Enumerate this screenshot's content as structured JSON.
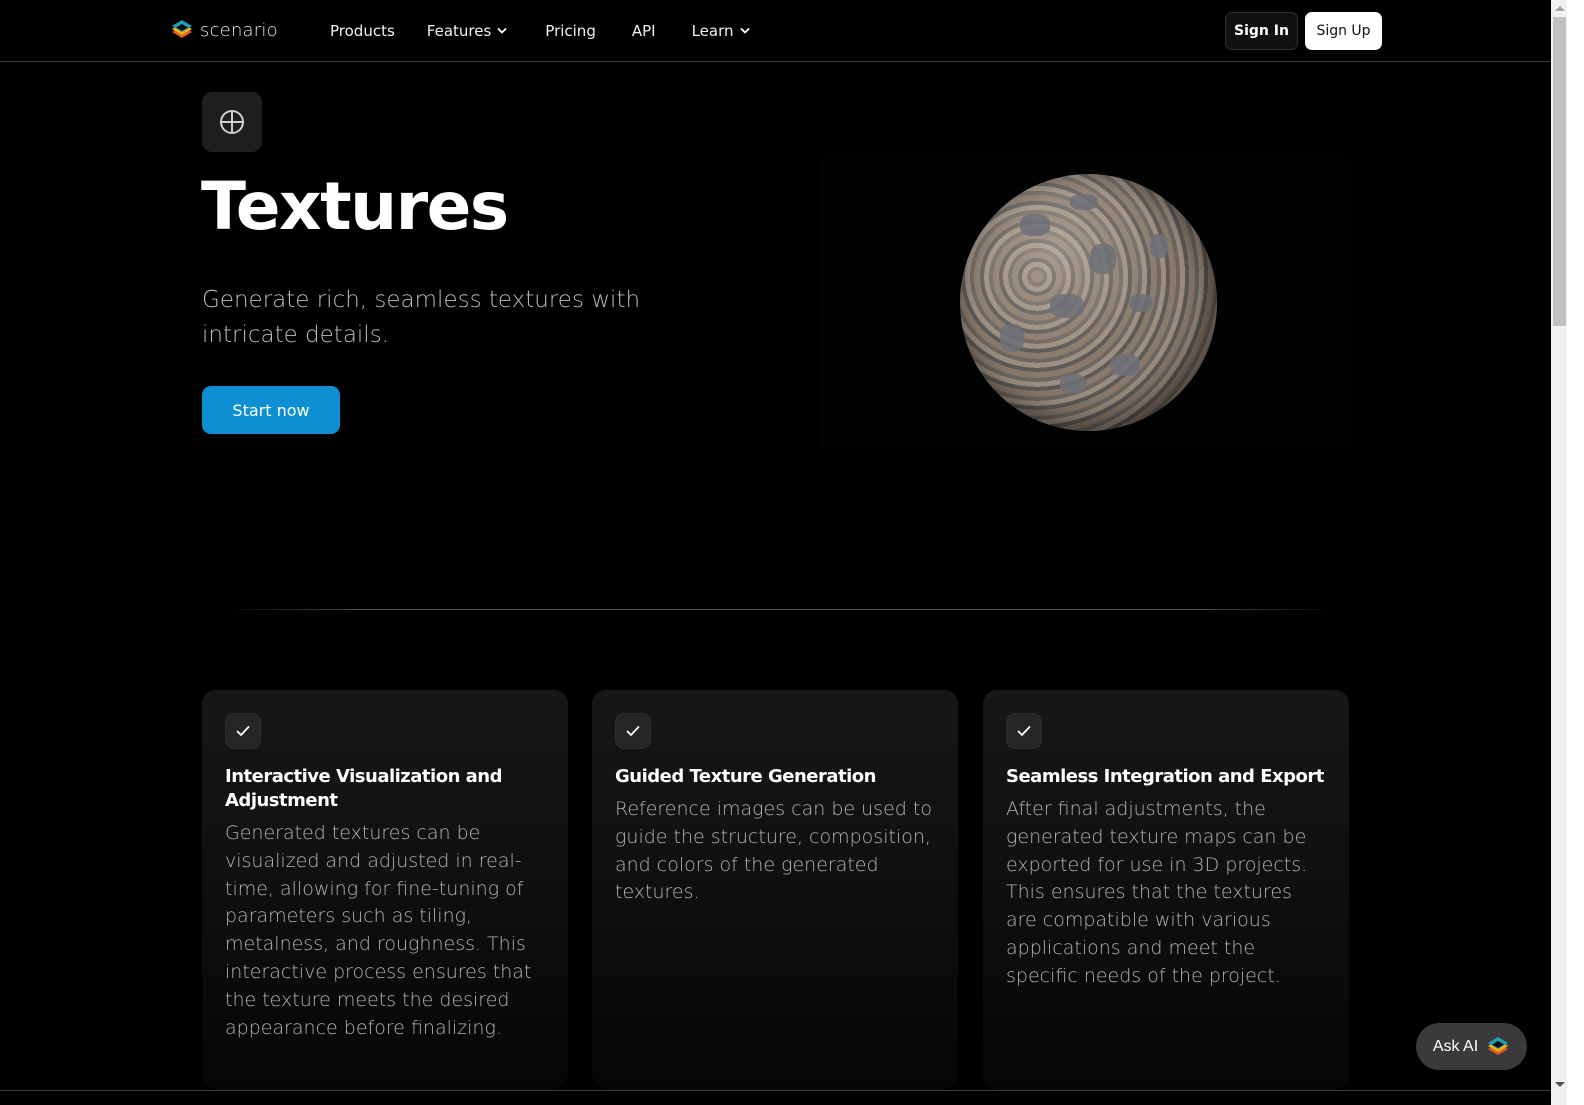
{
  "nav": {
    "logo_text": "scenario",
    "links": [
      {
        "label": "Products",
        "has_dropdown": false
      },
      {
        "label": "Features",
        "has_dropdown": true
      },
      {
        "label": "Pricing",
        "has_dropdown": false
      },
      {
        "label": "API",
        "has_dropdown": false
      },
      {
        "label": "Learn",
        "has_dropdown": true
      }
    ],
    "sign_in_label": "Sign In",
    "sign_up_label": "Sign Up"
  },
  "hero": {
    "icon": "globe-icon",
    "title": "Textures",
    "subtitle": "Generate rich, seamless textures with intricate details.",
    "cta_label": "Start now",
    "image_alt": "stone-texture-sphere"
  },
  "features": [
    {
      "icon": "check-icon",
      "title": "Interactive Visualization and Adjustment",
      "body": "Generated textures can be visualized and adjusted in real-time, allowing for fine-tuning of parameters such as tiling, metalness, and roughness. This interactive process ensures that the texture meets the desired appearance before finalizing."
    },
    {
      "icon": "check-icon",
      "title": "Guided Texture Generation",
      "body": "Reference images can be used to guide the structure, composition, and colors of the generated textures."
    },
    {
      "icon": "check-icon",
      "title": "Seamless Integration and Export",
      "body": "After final adjustments, the generated texture maps can be exported for use in 3D projects. This ensures that the textures are compatible with various applications and meet the specific needs of the project."
    }
  ],
  "ask_ai": {
    "label": "Ask AI"
  },
  "colors": {
    "background": "#000000",
    "accent": "#0e8fd4",
    "card": "#171717",
    "text_muted": "#b4b4b4"
  }
}
